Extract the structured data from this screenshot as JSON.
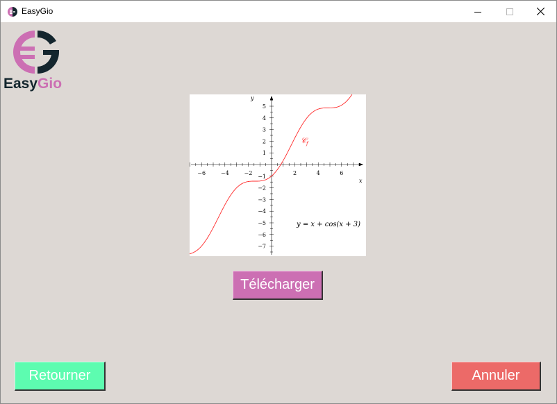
{
  "window": {
    "title": "EasyGio",
    "controls": {
      "minimize": "minimize",
      "maximize": "maximize",
      "close": "close"
    }
  },
  "logo": {
    "part1": "Easy",
    "part2": "Gio",
    "colors": {
      "dark": "#14262e",
      "pink": "#cc6fb3"
    }
  },
  "graph": {
    "x_ticks": [
      "−6",
      "−4",
      "−2",
      "2",
      "4",
      "6"
    ],
    "y_ticks": [
      "5",
      "4",
      "3",
      "2",
      "1",
      "−1",
      "−2",
      "−3",
      "−4",
      "−5",
      "−6",
      "−7"
    ],
    "x_label": "x",
    "y_label": "y",
    "curve_label": "𝒞",
    "curve_label_sub": "f",
    "equation": "y = x + cos(x + 3)",
    "curve_color": "#ff2a2a"
  },
  "buttons": {
    "download": "Télécharger",
    "back": "Retourner",
    "cancel": "Annuler"
  },
  "colors": {
    "background": "#ddd8d4",
    "download": "#cc6fb3",
    "back": "#5dfcb0",
    "cancel": "#ec6a68"
  }
}
